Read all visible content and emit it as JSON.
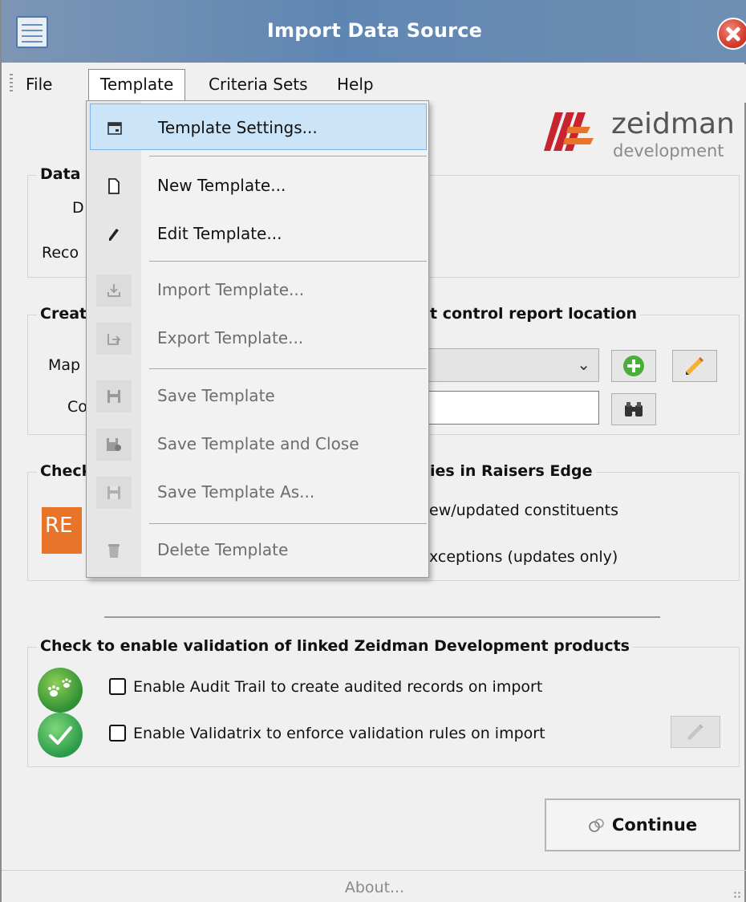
{
  "window": {
    "title": "Import Data Source"
  },
  "menubar": {
    "items": [
      "File",
      "Template",
      "Criteria Sets",
      "Help"
    ]
  },
  "logo": {
    "brand": "zeidman",
    "sub": "development"
  },
  "data_source_group": {
    "title": "Data S",
    "labels": [
      "D",
      "Reco"
    ]
  },
  "create_group": {
    "title": "Creat",
    "title_right": "t control report location",
    "labels": [
      "Map",
      "Co"
    ]
  },
  "check_group": {
    "title": "Check",
    "title_right": "ies in Raisers Edge",
    "options": [
      "ew/updated constituents",
      "xceptions (updates only)"
    ],
    "re_logo": "RE"
  },
  "linked_group": {
    "title": "Check to enable validation of linked Zeidman Development products",
    "audit_trail": {
      "label": "Enable Audit Trail to create audited records on import",
      "checked": false
    },
    "validatrix": {
      "label": "Enable Validatrix to enforce validation rules on import",
      "checked": false
    }
  },
  "continue_label": "Continue",
  "status": {
    "about": "About..."
  },
  "template_menu": {
    "items": [
      {
        "label": "Template Settings...",
        "icon": "window-icon",
        "enabled": true,
        "highlighted": true
      },
      {
        "label": "New Template...",
        "icon": "new-file-icon",
        "enabled": true
      },
      {
        "label": "Edit Template...",
        "icon": "pencil-icon",
        "enabled": true
      },
      {
        "label": "Import Template...",
        "icon": "import-icon",
        "enabled": false
      },
      {
        "label": "Export Template...",
        "icon": "export-icon",
        "enabled": false
      },
      {
        "label": "Save Template",
        "icon": "save-icon",
        "enabled": false
      },
      {
        "label": "Save Template and Close",
        "icon": "save-close-icon",
        "enabled": false
      },
      {
        "label": "Save Template As...",
        "icon": "save-as-icon",
        "enabled": false
      },
      {
        "label": "Delete Template",
        "icon": "trash-icon",
        "enabled": false
      }
    ]
  },
  "colors": {
    "titlebar": "#5f86b3",
    "highlight": "#cce4f7",
    "re_orange": "#e8742a",
    "add_green": "#4cae3a"
  }
}
